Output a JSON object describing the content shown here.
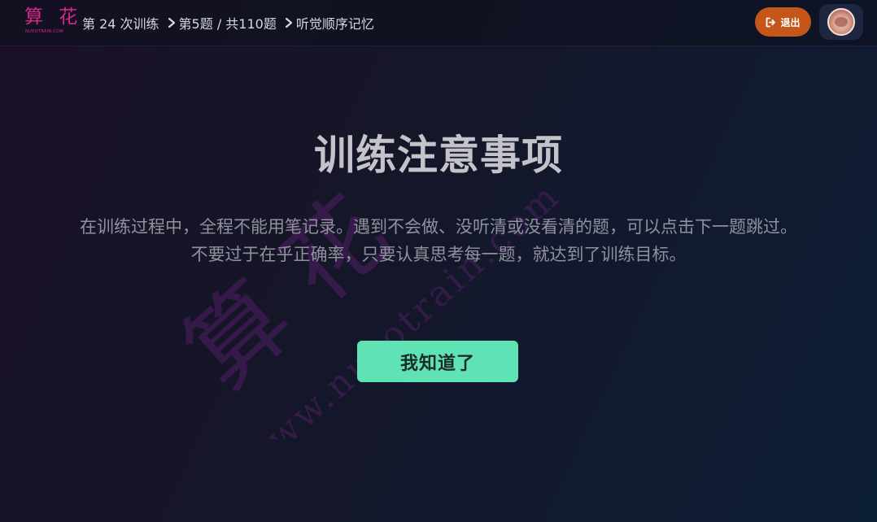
{
  "logo": {
    "mark": "算 花",
    "sub": "NUROTRAIN.COM"
  },
  "breadcrumb": {
    "session": "第 24 次训练",
    "progress": "第5题 / 共110题",
    "task": "听觉顺序记忆",
    "separator_icon": "chevron-right-icon"
  },
  "header": {
    "exit_label": "退出",
    "exit_icon": "sign-out-icon",
    "exit_color": "#c4561a"
  },
  "watermark": {
    "brand": "算 花",
    "domain": "www.nurotrain.com"
  },
  "main": {
    "title": "训练注意事项",
    "notes": [
      "在训练过程中，全程不能用笔记录。遇到不会做、没听清或没看清的题，可以点击下一题跳过。",
      "不要过于在乎正确率，只要认真思考每一题，就达到了训练目标。"
    ],
    "confirm_label": "我知道了",
    "confirm_color": "#5fe3b4"
  }
}
